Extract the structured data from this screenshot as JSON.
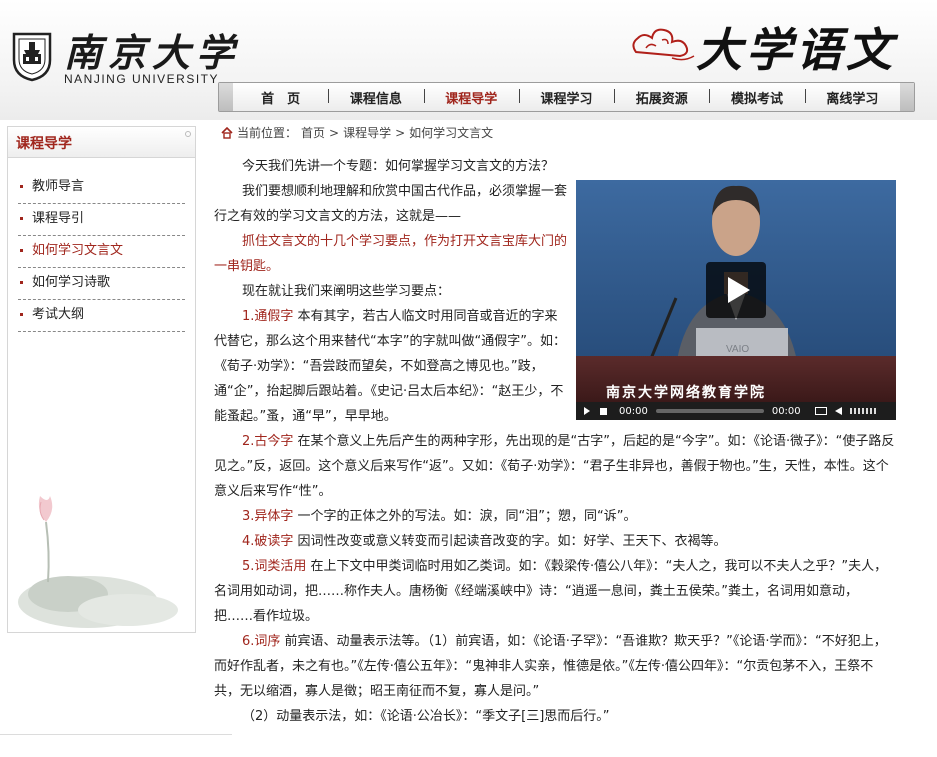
{
  "header": {
    "logo_cn": "南京大学",
    "logo_en": "NANJING UNIVERSITY",
    "brand_title": "大学语文"
  },
  "nav": {
    "items": [
      {
        "label": "首　页"
      },
      {
        "label": "课程信息"
      },
      {
        "label": "课程导学"
      },
      {
        "label": "课程学习"
      },
      {
        "label": "拓展资源"
      },
      {
        "label": "模拟考试"
      },
      {
        "label": "离线学习"
      }
    ],
    "active_index": 2
  },
  "sidebar": {
    "title": "课程导学",
    "items": [
      {
        "label": "教师导言"
      },
      {
        "label": "课程导引"
      },
      {
        "label": "如何学习文言文"
      },
      {
        "label": "如何学习诗歌"
      },
      {
        "label": "考试大纲"
      }
    ]
  },
  "breadcrumb": {
    "prefix": "当前位置：",
    "items": [
      "首页",
      "课程导学",
      "如何学习文言文"
    ],
    "separator": ">"
  },
  "video": {
    "caption": "南京大学网络教育学院",
    "time_current": "00:00",
    "time_total": "00:00"
  },
  "content": {
    "p1": "今天我们先讲一个专题：如何掌握学习文言文的方法？",
    "p2": "我们要想顺利地理解和欣赏中国古代作品，必须掌握一套行之有效的学习文言文的方法，这就是——",
    "p3": "抓住文言文的十几个学习要点，作为打开文言宝库大门的一串钥匙。",
    "p4": "现在就让我们来阐明这些学习要点：",
    "p5_head": "1.通假字",
    "p5_body": " 本有其字，若古人临文时用同音或音近的字来代替它，那么这个用来替代“本字”的字就叫做“通假字”。如：《荀子·劝学》：“吾尝跂而望矣，不如登高之博见也。”跂，通“企”，抬起脚后跟站着。《史记·吕太后本纪》：“赵王少，不能蚤起。”蚤，通“早”，早早地。",
    "p6_head": "2.古今字",
    "p6_body": " 在某个意义上先后产生的两种字形，先出现的是“古字”，后起的是“今字”。如：《论语·微子》：“使子路反见之。”反，返回。这个意义后来写作“返”。又如：《荀子·劝学》：“君子生非异也，善假于物也。”生，天性，本性。这个意义后来写作“性”。",
    "p7_head": "3.异体字",
    "p7_body": " 一个字的正体之外的写法。如：淚，同“泪”；愬，同“诉”。",
    "p8_head": "4.破读字",
    "p8_body": " 因词性改变或意义转变而引起读音改变的字。如：好学、王天下、衣褐等。",
    "p9_head": "5.词类活用",
    "p9_body": " 在上下文中甲类词临时用如乙类词。如：《穀梁传·僖公八年》：“夫人之，我可以不夫人之乎？”夫人，名词用如动词，把……称作夫人。唐杨衡《经端溪峡中》诗：“逍遥一息间，粪土五侯荣。”粪土，名词用如意动，把……看作垃圾。",
    "p10_head": "6.词序",
    "p10_body": " 前宾语、动量表示法等。（1）前宾语，如：《论语·子罕》：“吾谁欺？欺天乎？”《论语·学而》：“不好犯上，而好作乱者，未之有也。”《左传·僖公五年》：“鬼神非人实亲，惟德是依。”《左传·僖公四年》：“尔贡包茅不入，王祭不共，无以缩酒，寡人是徵；昭王南征而不复，寡人是问。”",
    "p11": "（2）动量表示法，如：《论语·公冶长》：“季文子[三]思而后行。”"
  }
}
